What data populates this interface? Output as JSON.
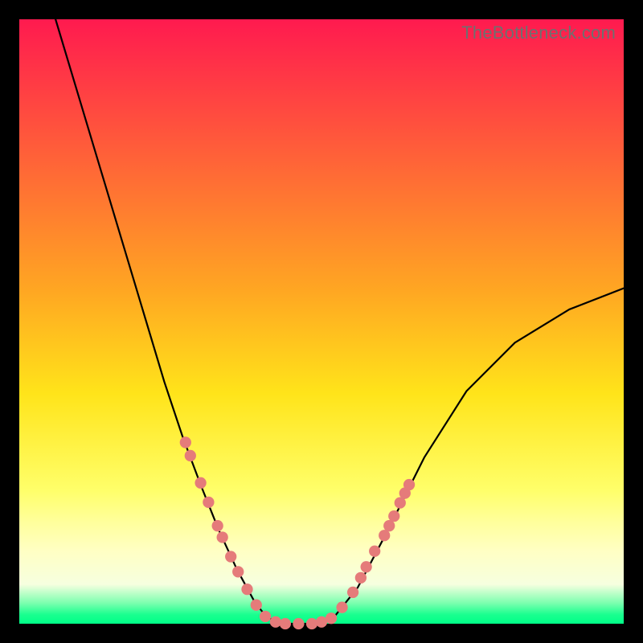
{
  "watermark": {
    "text": "TheBottleneck.com"
  },
  "chart_data": {
    "type": "line",
    "title": "",
    "xlabel": "",
    "ylabel": "",
    "xlim": [
      0,
      1
    ],
    "ylim": [
      0,
      1
    ],
    "gradient_stops": [
      {
        "offset": 0.0,
        "color": "#ff1a4f"
      },
      {
        "offset": 0.45,
        "color": "#ffa722"
      },
      {
        "offset": 0.62,
        "color": "#ffe41a"
      },
      {
        "offset": 0.78,
        "color": "#ffff6a"
      },
      {
        "offset": 0.83,
        "color": "#ffff9a"
      },
      {
        "offset": 0.88,
        "color": "#ffffc4"
      },
      {
        "offset": 0.935,
        "color": "#f6ffdf"
      },
      {
        "offset": 0.965,
        "color": "#7fffb0"
      },
      {
        "offset": 0.985,
        "color": "#1aff8f"
      },
      {
        "offset": 1.0,
        "color": "#00ff88"
      }
    ],
    "series": [
      {
        "name": "left-branch",
        "x": [
          0.06,
          0.09,
          0.12,
          0.15,
          0.18,
          0.21,
          0.24,
          0.27,
          0.3,
          0.33,
          0.36,
          0.39,
          0.41
        ],
        "y": [
          1.0,
          0.9,
          0.8,
          0.7,
          0.6,
          0.5,
          0.4,
          0.31,
          0.23,
          0.155,
          0.09,
          0.035,
          0.01
        ]
      },
      {
        "name": "valley-floor",
        "x": [
          0.41,
          0.44,
          0.48,
          0.52
        ],
        "y": [
          0.01,
          0.0,
          0.0,
          0.01
        ]
      },
      {
        "name": "right-branch",
        "x": [
          0.52,
          0.56,
          0.61,
          0.67,
          0.74,
          0.82,
          0.91,
          1.0
        ],
        "y": [
          0.01,
          0.06,
          0.155,
          0.275,
          0.385,
          0.465,
          0.52,
          0.555
        ]
      }
    ],
    "markers": {
      "color": "#e57b7a",
      "radius_norm": 0.0095,
      "points": [
        {
          "x": 0.275,
          "y": 0.3
        },
        {
          "x": 0.283,
          "y": 0.278
        },
        {
          "x": 0.3,
          "y": 0.233
        },
        {
          "x": 0.313,
          "y": 0.201
        },
        {
          "x": 0.328,
          "y": 0.162
        },
        {
          "x": 0.336,
          "y": 0.143
        },
        {
          "x": 0.35,
          "y": 0.111
        },
        {
          "x": 0.362,
          "y": 0.086
        },
        {
          "x": 0.377,
          "y": 0.057
        },
        {
          "x": 0.392,
          "y": 0.031
        },
        {
          "x": 0.407,
          "y": 0.012
        },
        {
          "x": 0.424,
          "y": 0.003
        },
        {
          "x": 0.44,
          "y": 0.0
        },
        {
          "x": 0.462,
          "y": 0.0
        },
        {
          "x": 0.484,
          "y": 0.0
        },
        {
          "x": 0.5,
          "y": 0.003
        },
        {
          "x": 0.516,
          "y": 0.009
        },
        {
          "x": 0.534,
          "y": 0.027
        },
        {
          "x": 0.552,
          "y": 0.052
        },
        {
          "x": 0.565,
          "y": 0.076
        },
        {
          "x": 0.574,
          "y": 0.094
        },
        {
          "x": 0.588,
          "y": 0.12
        },
        {
          "x": 0.604,
          "y": 0.146
        },
        {
          "x": 0.612,
          "y": 0.162
        },
        {
          "x": 0.62,
          "y": 0.178
        },
        {
          "x": 0.63,
          "y": 0.2
        },
        {
          "x": 0.638,
          "y": 0.216
        },
        {
          "x": 0.645,
          "y": 0.23
        }
      ]
    }
  }
}
